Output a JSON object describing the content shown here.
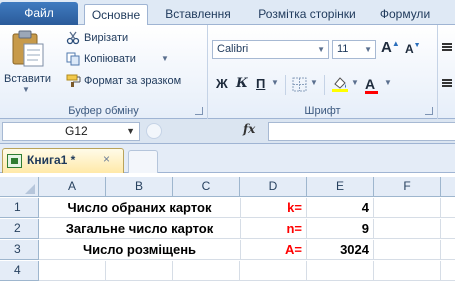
{
  "ribbon_tabs": {
    "file": "Файл",
    "home": "Основне",
    "insert": "Вставлення",
    "page_layout": "Розмітка сторінки",
    "formulas": "Формули"
  },
  "clipboard": {
    "paste_label": "Вставити",
    "cut_label": "Вирізати",
    "copy_label": "Копіювати",
    "format_painter_label": "Формат за зразком",
    "group_label": "Буфер обміну"
  },
  "font": {
    "name": "Calibri",
    "size": "11",
    "grow_label": "A",
    "shrink_label": "A",
    "bold_label": "Ж",
    "italic_label": "К",
    "underline_label": "П",
    "font_color_label": "A",
    "group_label": "Шрифт"
  },
  "formula_bar": {
    "name_box": "G12",
    "fx": "fx",
    "formula": ""
  },
  "workbook": {
    "tab_title": "Книга1 *",
    "close_glyph": "×"
  },
  "grid": {
    "columns": [
      "A",
      "B",
      "C",
      "D",
      "E",
      "F"
    ],
    "row_numbers": [
      "1",
      "2",
      "3",
      "4"
    ],
    "rows": [
      {
        "label": "Число обраних карток",
        "var": "k=",
        "value": "4"
      },
      {
        "label": "Загальне число карток",
        "var": "n=",
        "value": "9"
      },
      {
        "label": "Число розміщень",
        "var": "A=",
        "value": "3024"
      }
    ]
  },
  "colors": {
    "accent": "#2b5b9a",
    "variable_red": "#ff0000",
    "header_bg": "#e4ecf7"
  },
  "icons": [
    "paste-icon",
    "scissors-icon",
    "copy-icon",
    "brush-icon",
    "border-icon",
    "fill-color-icon",
    "font-color-icon",
    "excel-doc-icon",
    "close-icon",
    "fx-icon",
    "select-all-icon"
  ]
}
